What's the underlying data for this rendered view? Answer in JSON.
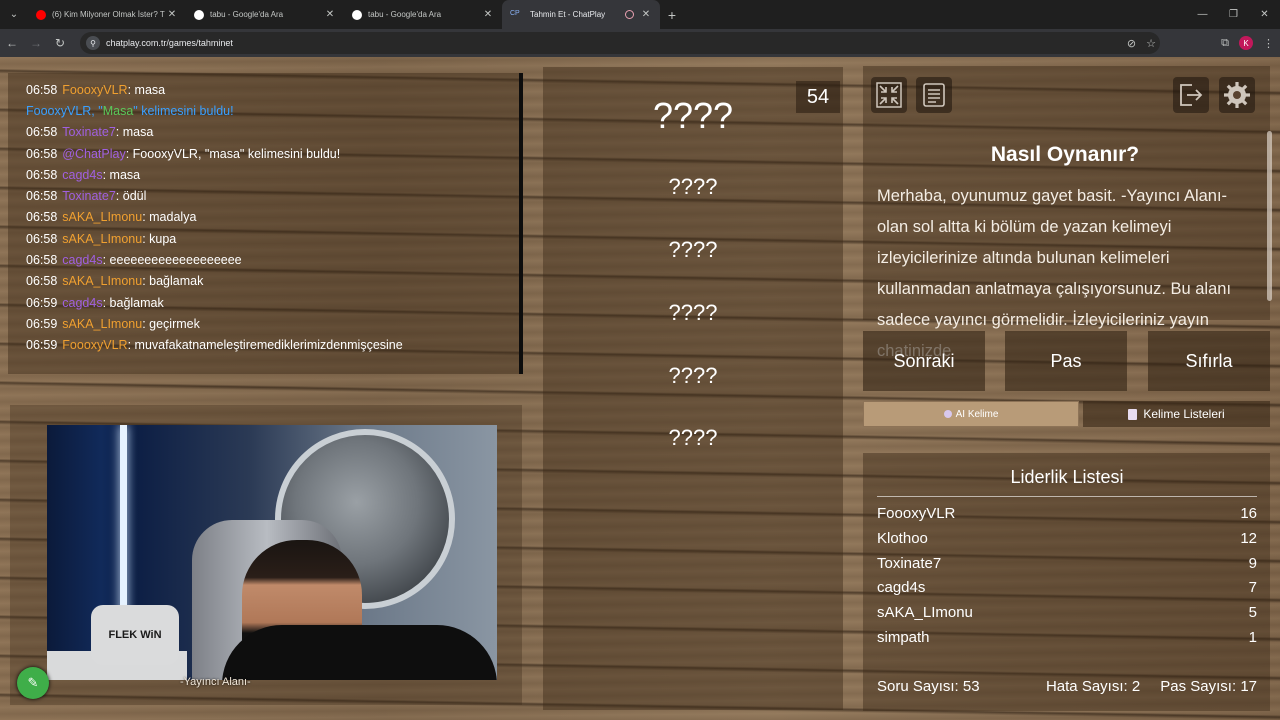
{
  "browser": {
    "tabs": [
      {
        "title": "(6) Kim Milyoner Olmak İster? T",
        "favicon_color": "#ff0000"
      },
      {
        "title": "tabu - Google'da Ara",
        "favicon_color": "#ffffff"
      },
      {
        "title": "tabu - Google'da Ara",
        "favicon_color": "#ffffff"
      },
      {
        "title": "Tahmin Et - ChatPlay",
        "favicon_text": "CP",
        "active": true
      }
    ],
    "url": "chatplay.com.tr/games/tahminet",
    "profile_initial": "K"
  },
  "chat": {
    "lines": [
      {
        "time": "06:58",
        "user": "FoooxyVLR",
        "user_color": "#f0a030",
        "message": ": masa"
      },
      {
        "system": true,
        "prefix": "FoooxyVLR, \"",
        "word": "Masa",
        "suffix": "\" kelimesini buldu!"
      },
      {
        "time": "06:58",
        "user": "Toxinate7",
        "user_color": "#a060e0",
        "message": ": masa"
      },
      {
        "time": "06:58",
        "user": "@ChatPlay",
        "user_color": "#a060e0",
        "message": ": FoooxyVLR, \"masa\" kelimesini buldu!"
      },
      {
        "time": "06:58",
        "user": "cagd4s",
        "user_color": "#a060e0",
        "message": ": masa"
      },
      {
        "time": "06:58",
        "user": "Toxinate7",
        "user_color": "#a060e0",
        "message": ": ödül"
      },
      {
        "time": "06:58",
        "user": "sAKA_LImonu",
        "user_color": "#f0a030",
        "message": ": madalya"
      },
      {
        "time": "06:58",
        "user": "sAKA_LImonu",
        "user_color": "#f0a030",
        "message": ": kupa"
      },
      {
        "time": "06:58",
        "user": "cagd4s",
        "user_color": "#a060e0",
        "message": ": eeeeeeeeeeeeeeeeeee"
      },
      {
        "time": "06:58",
        "user": "sAKA_LImonu",
        "user_color": "#f0a030",
        "message": ": bağlamak"
      },
      {
        "time": "06:59",
        "user": "cagd4s",
        "user_color": "#a060e0",
        "message": ": bağlamak"
      },
      {
        "time": "06:59",
        "user": "sAKA_LImonu",
        "user_color": "#f0a030",
        "message": ": geçirmek"
      },
      {
        "time": "06:59",
        "user": "FoooxyVLR",
        "user_color": "#f0a030",
        "message": ": muvafakatnameleştiremediklerimizdenmişçesine"
      }
    ]
  },
  "webcam": {
    "pillow_text": "FLEK WiN",
    "label": "-Yayıncı Alanı-"
  },
  "game": {
    "timer": "54",
    "main_word": "????",
    "forbidden_words": [
      "????",
      "????",
      "????",
      "????",
      "????"
    ]
  },
  "help": {
    "title": "Nasıl Oynanır?",
    "text": "Merhaba, oyunumuz gayet basit. -Yayıncı Alanı- olan sol altta ki bölüm de yazan kelimeyi izleyicilerinize altında bulunan kelimeleri kullanmadan anlatmaya çalışıyorsunuz. Bu alanı sadece yayıncı görmelidir. İzleyicileriniz yayın chatinizde"
  },
  "actions": {
    "next": "Sonraki",
    "pass": "Pas",
    "reset": "Sıfırla",
    "ai_word": "AI Kelime",
    "word_lists": "Kelime Listeleri"
  },
  "leaderboard": {
    "title": "Liderlik Listesi",
    "rows": [
      {
        "name": "FoooxyVLR",
        "score": "16"
      },
      {
        "name": "Klothoo",
        "score": "12"
      },
      {
        "name": "Toxinate7",
        "score": "9"
      },
      {
        "name": "cagd4s",
        "score": "7"
      },
      {
        "name": "sAKA_LImonu",
        "score": "5"
      },
      {
        "name": "simpath",
        "score": "1"
      }
    ]
  },
  "stats": {
    "questions": "Soru Sayısı: 53",
    "errors": "Hata Sayısı: 2",
    "passes": "Pas Sayısı: 17"
  }
}
